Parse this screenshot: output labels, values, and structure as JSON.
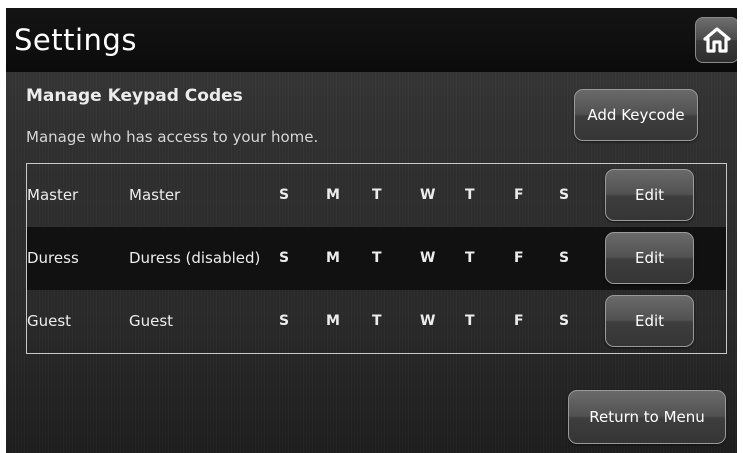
{
  "header": {
    "title": "Settings",
    "home_icon": "home-icon"
  },
  "section": {
    "heading": "Manage Keypad Codes",
    "description": "Manage who has access to your home.",
    "add_button": "Add Keycode"
  },
  "codes": [
    {
      "name": "Master",
      "type": "Master",
      "days": [
        "S",
        "M",
        "T",
        "W",
        "T",
        "F",
        "S"
      ],
      "edit": "Edit"
    },
    {
      "name": "Duress",
      "type": "Duress (disabled)",
      "days": [
        "S",
        "M",
        "T",
        "W",
        "T",
        "F",
        "S"
      ],
      "edit": "Edit"
    },
    {
      "name": "Guest",
      "type": "Guest",
      "days": [
        "S",
        "M",
        "T",
        "W",
        "T",
        "F",
        "S"
      ],
      "edit": "Edit"
    }
  ],
  "footer": {
    "return_button": "Return to Menu"
  },
  "colors": {
    "header_bg": "#0b0b0b",
    "panel_bg": "#303030",
    "alt_row_bg": "#111111",
    "text": "#ececec"
  }
}
